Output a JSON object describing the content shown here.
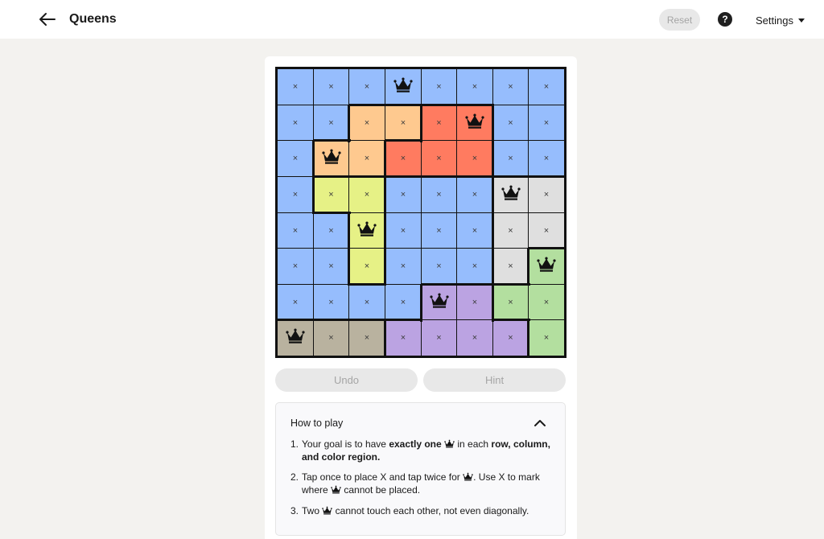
{
  "header": {
    "title": "Queens",
    "reset_label": "Reset",
    "help_label": "?",
    "settings_label": "Settings"
  },
  "board": {
    "size": 8,
    "colors": {
      "blue": "#96bdfd",
      "orange": "#fec98f",
      "red": "#ff7b60",
      "yellow": "#e6f186",
      "gray": "#dfdfdf",
      "green": "#b3df9f",
      "purple": "#bba3e2",
      "tan": "#b9b29f"
    },
    "regions": [
      [
        "blue",
        "blue",
        "blue",
        "blue",
        "blue",
        "blue",
        "blue",
        "blue"
      ],
      [
        "blue",
        "blue",
        "orange",
        "orange",
        "red",
        "red",
        "blue",
        "blue"
      ],
      [
        "blue",
        "orange",
        "orange",
        "red",
        "red",
        "red",
        "blue",
        "blue"
      ],
      [
        "blue",
        "yellow",
        "yellow",
        "blue",
        "blue",
        "blue",
        "gray",
        "gray"
      ],
      [
        "blue",
        "blue",
        "yellow",
        "blue",
        "blue",
        "blue",
        "gray",
        "gray"
      ],
      [
        "blue",
        "blue",
        "yellow",
        "blue",
        "blue",
        "blue",
        "gray",
        "green"
      ],
      [
        "blue",
        "blue",
        "blue",
        "blue",
        "purple",
        "purple",
        "green",
        "green"
      ],
      [
        "tan",
        "tan",
        "tan",
        "purple",
        "purple",
        "purple",
        "purple",
        "green"
      ]
    ],
    "cells": [
      [
        "x",
        "x",
        "x",
        "queen",
        "x",
        "x",
        "x",
        "x"
      ],
      [
        "x",
        "x",
        "x",
        "x",
        "x",
        "queen",
        "x",
        "x"
      ],
      [
        "x",
        "queen",
        "x",
        "x",
        "x",
        "x",
        "x",
        "x"
      ],
      [
        "x",
        "x",
        "x",
        "x",
        "x",
        "x",
        "queen",
        "x"
      ],
      [
        "x",
        "x",
        "queen",
        "x",
        "x",
        "x",
        "x",
        "x"
      ],
      [
        "x",
        "x",
        "x",
        "x",
        "x",
        "x",
        "x",
        "queen"
      ],
      [
        "x",
        "x",
        "x",
        "x",
        "queen",
        "x",
        "x",
        "x"
      ],
      [
        "queen",
        "x",
        "x",
        "x",
        "x",
        "x",
        "x",
        "x"
      ]
    ],
    "x_symbol": "×"
  },
  "controls": {
    "undo_label": "Undo",
    "hint_label": "Hint"
  },
  "how_to_play": {
    "title": "How to play",
    "rule1": {
      "num": "1.",
      "a": "Your goal is to have ",
      "b": "exactly one",
      "c": " in each ",
      "d": "row, column, and color region."
    },
    "rule2": {
      "num": "2.",
      "a": "Tap once to place X and tap twice for ",
      "b": ". Use X to mark where ",
      "c": " cannot be placed."
    },
    "rule3": {
      "num": "3.",
      "a": "Two ",
      "b": " cannot touch each other, not even diagonally."
    }
  },
  "icons": {
    "back": "arrow-left-icon",
    "help": "question-circle-icon",
    "settings_caret": "caret-down-icon",
    "collapse": "chevron-up-icon",
    "queen": "crown-icon"
  }
}
